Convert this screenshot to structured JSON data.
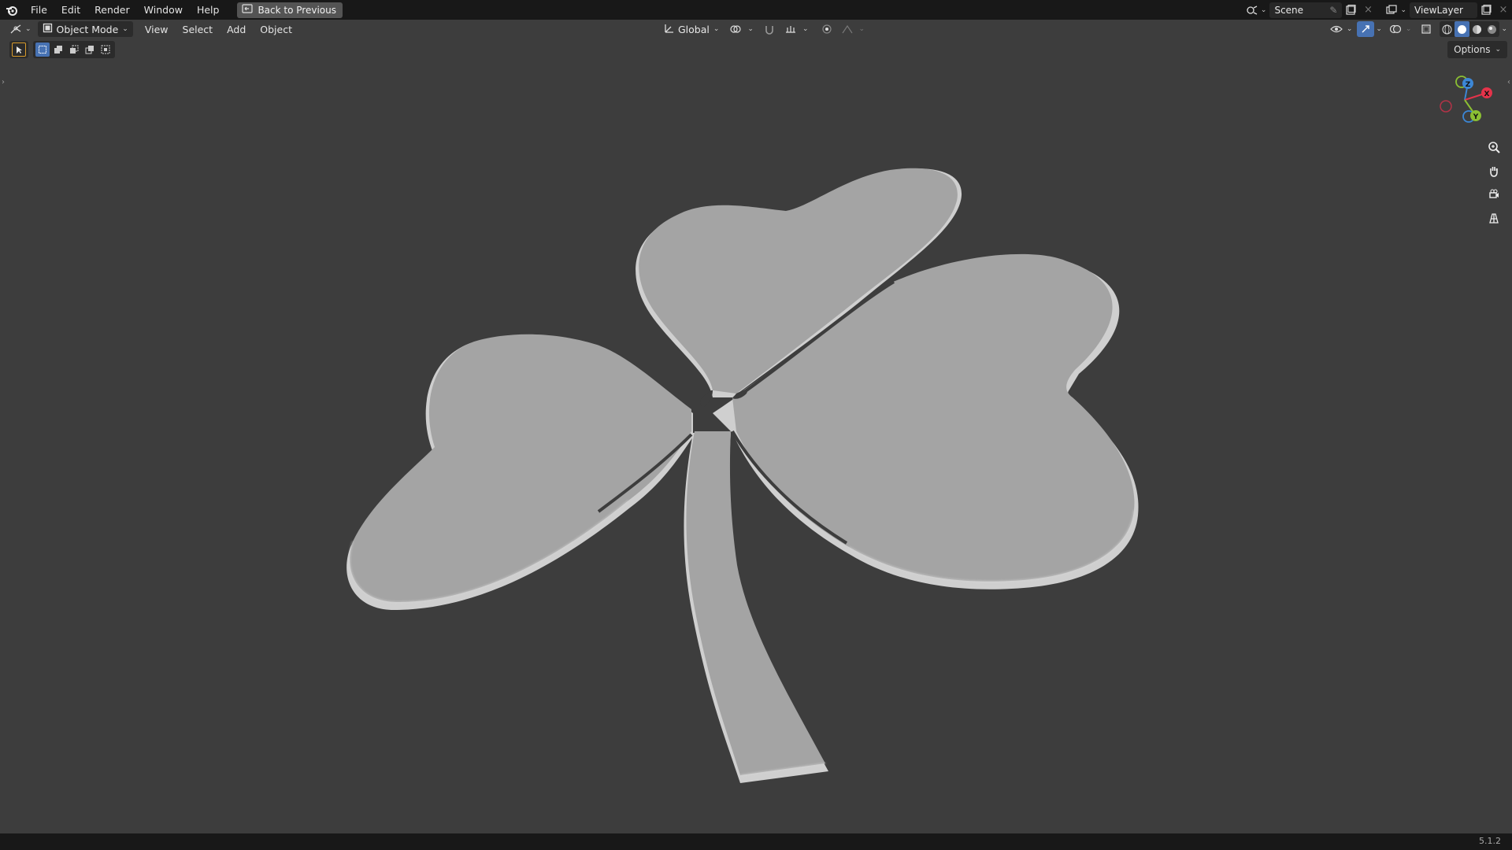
{
  "topbar": {
    "menus": [
      "File",
      "Edit",
      "Render",
      "Window",
      "Help"
    ],
    "back_button": "Back to Previous",
    "scene": "Scene",
    "view_layer": "ViewLayer"
  },
  "header": {
    "mode": "Object Mode",
    "menus": [
      "View",
      "Select",
      "Add",
      "Object"
    ],
    "orientation": "Global"
  },
  "options_label": "Options",
  "gizmo": {
    "x_label": "X",
    "y_label": "Y",
    "z_label": "Z",
    "colors": {
      "x": "#e5334a",
      "y": "#8bbf33",
      "z": "#3c87d6"
    }
  },
  "status": {
    "version": "5.1.2"
  },
  "colors": {
    "topbar_bg": "#181818",
    "viewport_bg": "#3d3d3d",
    "accent_blue": "#4772b3",
    "model_fill": "#a4a4a4"
  }
}
